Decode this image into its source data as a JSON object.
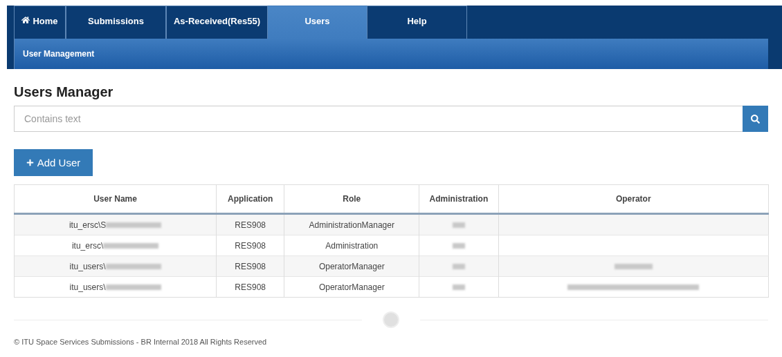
{
  "nav": {
    "tabs": [
      {
        "label": "Home",
        "selected": false
      },
      {
        "label": "Submissions",
        "selected": false
      },
      {
        "label": "As-Received(Res55)",
        "selected": false
      },
      {
        "label": "Users",
        "selected": true
      },
      {
        "label": "Help",
        "selected": false
      }
    ],
    "subnav": "User Management"
  },
  "heading": "Users Manager",
  "search": {
    "placeholder": "Contains text"
  },
  "add_button": "Add User",
  "table": {
    "columns": [
      "User Name",
      "Application",
      "Role",
      "Administration",
      "Operator"
    ],
    "rows": [
      {
        "user_name": "itu_ersc\\S",
        "user_name_redacted": true,
        "application": "RES908",
        "role": "AdministrationManager",
        "administration_redacted": true,
        "operator_redacted": false
      },
      {
        "user_name": "itu_ersc\\",
        "user_name_redacted": true,
        "application": "RES908",
        "role": "Administration",
        "administration_redacted": true,
        "operator_redacted": false
      },
      {
        "user_name": "itu_users\\",
        "user_name_redacted": true,
        "application": "RES908",
        "role": "OperatorManager",
        "administration_redacted": true,
        "operator_redacted": true
      },
      {
        "user_name": "itu_users\\",
        "user_name_redacted": true,
        "application": "RES908",
        "role": "OperatorManager",
        "administration_redacted": true,
        "operator_redacted": true
      }
    ]
  },
  "footer": "© ITU Space Services Submissions - BR Internal 2018 All Rights Reserved"
}
